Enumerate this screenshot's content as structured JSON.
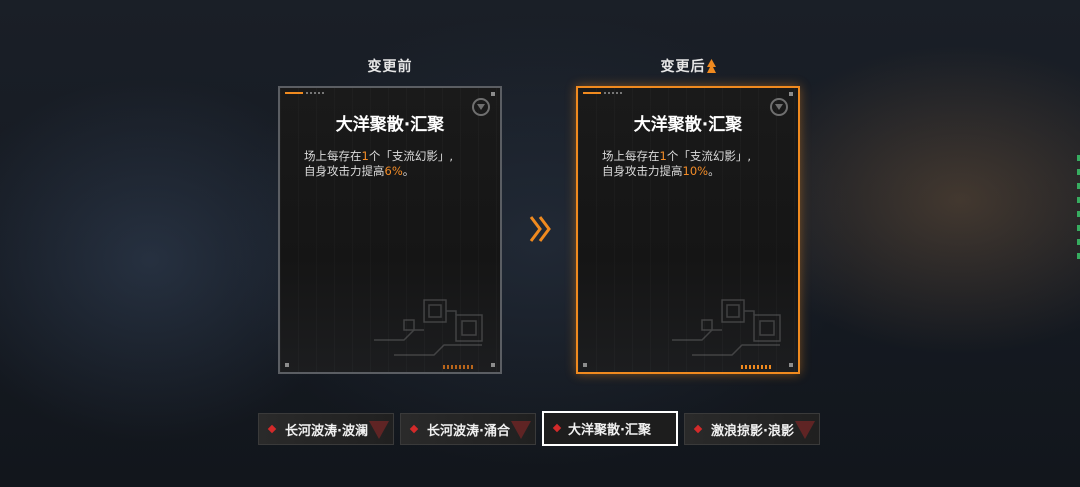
{
  "columns": {
    "before_label": "变更前",
    "after_label": "变更后"
  },
  "skill_before": {
    "title": "大洋聚散·汇聚",
    "desc_line1_a": "场上每存在",
    "desc_line1_num": "1",
    "desc_line1_b": "个「支流幻影」,",
    "desc_line2_a": "自身攻击力提高",
    "desc_line2_value": "6%",
    "desc_line2_b": "。"
  },
  "skill_after": {
    "title": "大洋聚散·汇聚",
    "desc_line1_a": "场上每存在",
    "desc_line1_num": "1",
    "desc_line1_b": "个「支流幻影」,",
    "desc_line2_a": "自身攻击力提高",
    "desc_line2_value": "10%",
    "desc_line2_b": "。"
  },
  "tabs": [
    {
      "label": "长河波涛·波澜",
      "active": false
    },
    {
      "label": "长河波涛·涌合",
      "active": false
    },
    {
      "label": "大洋聚散·汇聚",
      "active": true
    },
    {
      "label": "激浪掠影·浪影",
      "active": false
    }
  ],
  "colors": {
    "accent_orange": "#f08a1f",
    "highlight_text": "#f28c28",
    "tab_marker_red": "#d32a2a"
  },
  "icons": {
    "compare_arrow": "double-chevron-right-icon",
    "card_emblem": "faction-emblem-icon",
    "tab_marker": "red-diamond-icon"
  }
}
